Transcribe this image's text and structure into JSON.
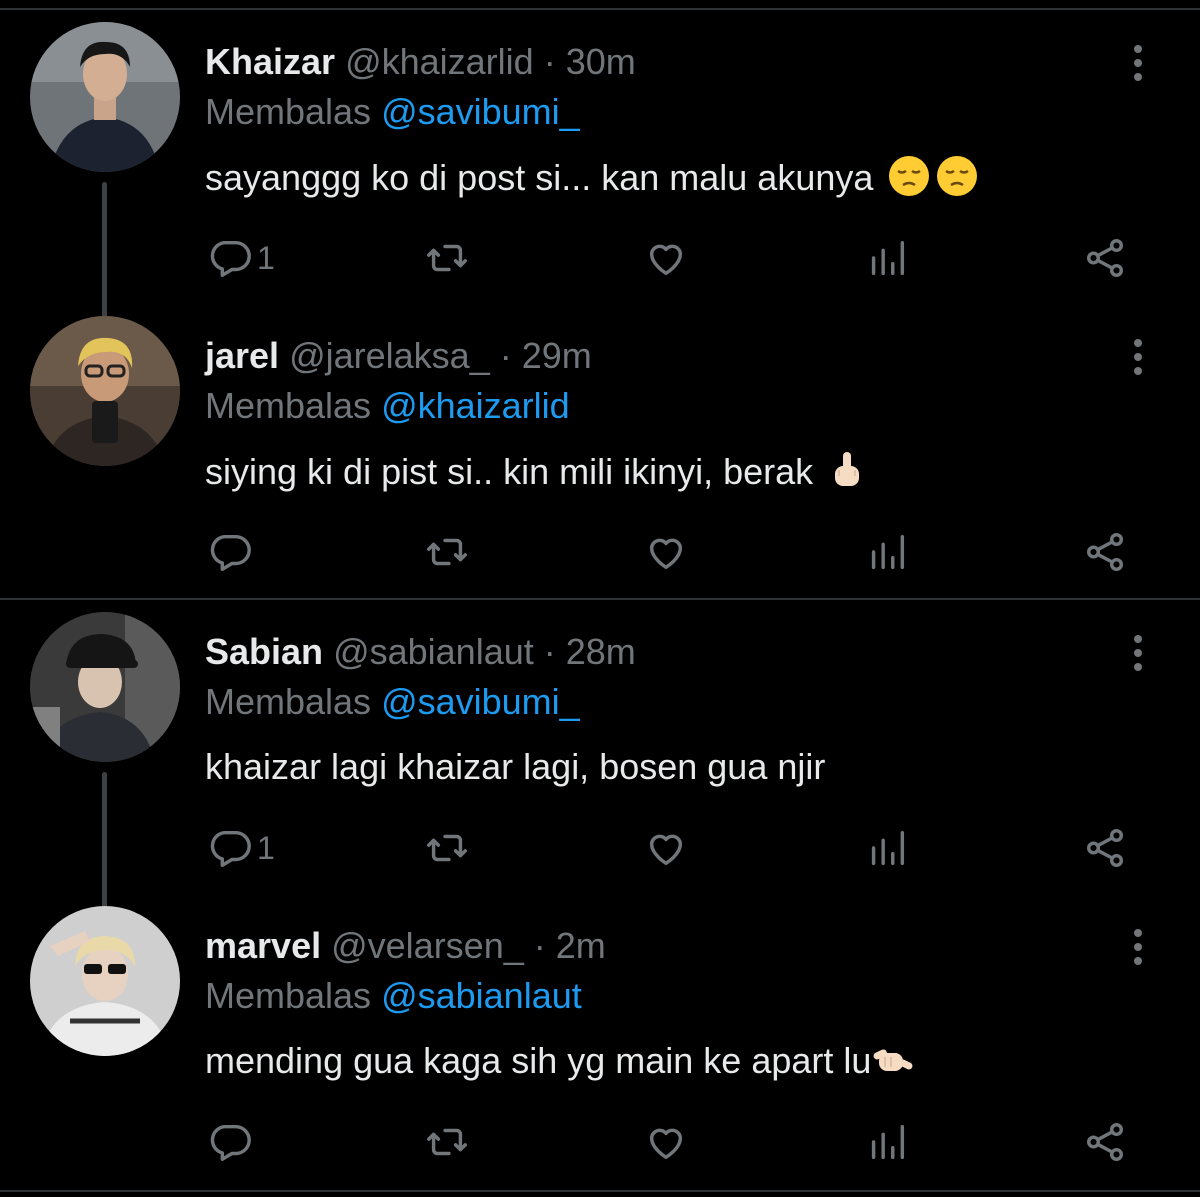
{
  "tweets": [
    {
      "name": "Khaizar",
      "handle": "@khaizarlid",
      "time": "30m",
      "reply_prefix": "Membalas",
      "reply_to": "@savibumi_",
      "text": "sayanggg ko di post si... kan malu akunya",
      "emoji": "pensive-face-x2",
      "reply_count": "1"
    },
    {
      "name": "jarel",
      "handle": "@jarelaksa_",
      "time": "29m",
      "reply_prefix": "Membalas",
      "reply_to": "@khaizarlid",
      "text": "siying ki di pist si.. kin mili ikinyi, berak",
      "emoji": "middle-finger",
      "reply_count": ""
    },
    {
      "name": "Sabian",
      "handle": "@sabianlaut",
      "time": "28m",
      "reply_prefix": "Membalas",
      "reply_to": "@savibumi_",
      "text": "khaizar lagi khaizar lagi, bosen gua njir",
      "emoji": "",
      "reply_count": "1"
    },
    {
      "name": "marvel",
      "handle": "@velarsen_",
      "time": "2m",
      "reply_prefix": "Membalas",
      "reply_to": "@sabianlaut",
      "text": "mending gua kaga sih yg main ke apart lu",
      "emoji": "call-me-hand",
      "reply_count": ""
    }
  ],
  "separator_dot": "·",
  "icons": [
    "reply-icon",
    "retweet-icon",
    "like-icon",
    "analytics-icon",
    "share-icon",
    "more-icon"
  ],
  "colors": {
    "background": "#000000",
    "text": "#e7e9ea",
    "muted": "#71767b",
    "accent": "#1d9bf0"
  }
}
